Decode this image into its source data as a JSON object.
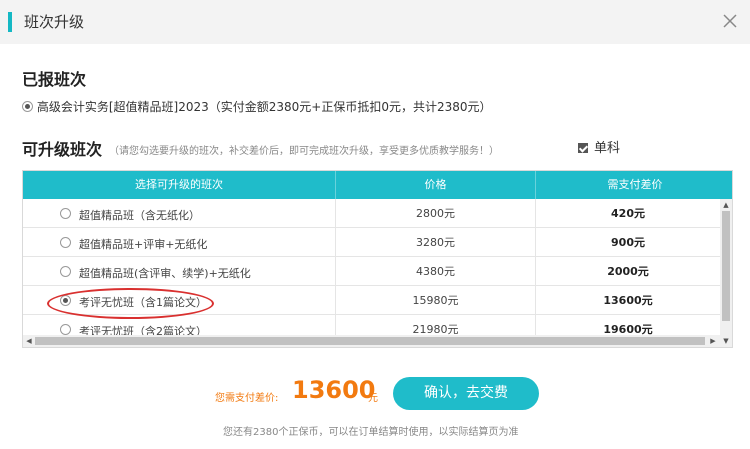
{
  "dialog": {
    "title": "班次升级",
    "close_icon": "close-icon"
  },
  "registered": {
    "heading": "已报班次",
    "item": "高级会计实务[超值精品班]2023（实付金额2380元+正保币抵扣0元，共计2380元）"
  },
  "upgrade": {
    "heading": "可升级班次",
    "hint": "（请您勾选要升级的班次，补交差价后，即可完成班次升级，享受更多优质教学服务！）",
    "single_label": "单科",
    "single_checked": true
  },
  "table": {
    "columns": [
      "选择可升级的班次",
      "价格",
      "需支付差价"
    ],
    "rows": [
      {
        "name": "超值精品班（含无纸化）",
        "price": "2800元",
        "diff": "420元",
        "selected": false
      },
      {
        "name": "超值精品班+评审+无纸化",
        "price": "3280元",
        "diff": "900元",
        "selected": false
      },
      {
        "name": "超值精品班(含评审、续学)+无纸化",
        "price": "4380元",
        "diff": "2000元",
        "selected": false
      },
      {
        "name": "考评无忧班（含1篇论文）",
        "price": "15980元",
        "diff": "13600元",
        "selected": true
      },
      {
        "name": "考评无忧班（含2篇论文）",
        "price": "21980元",
        "diff": "19600元",
        "selected": false
      }
    ]
  },
  "footer": {
    "pay_label": "您需支付差价:",
    "pay_amount": "13600",
    "pay_unit": "元",
    "confirm_label": "确认，去交费",
    "note": "您还有2380个正保币，可以在订单结算时使用，以实际结算页为准"
  },
  "colors": {
    "accent": "#1fbcca",
    "price": "#f27a10",
    "highlight": "#d9302f"
  }
}
